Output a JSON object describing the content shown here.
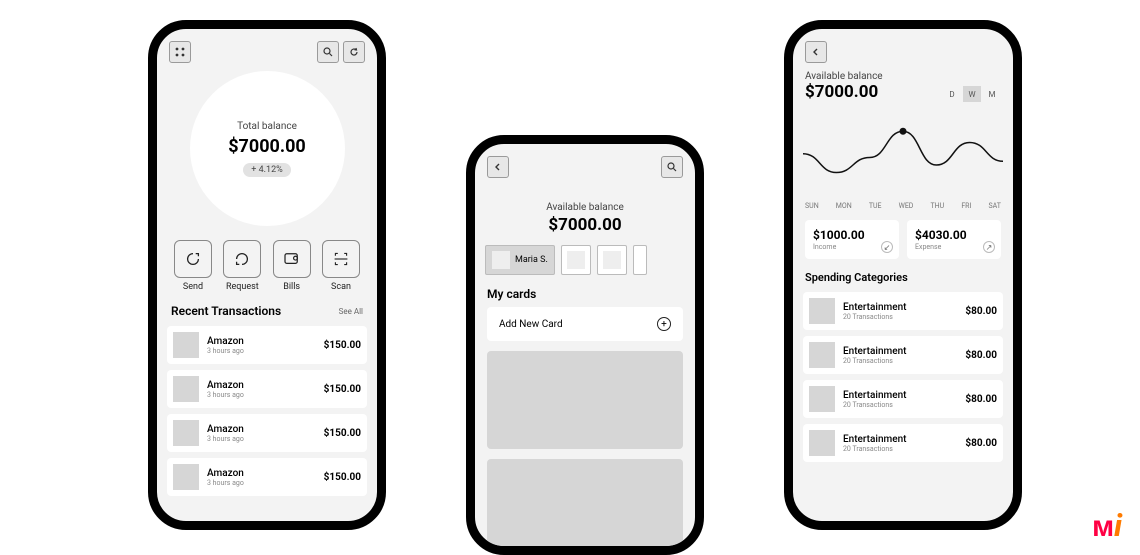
{
  "home": {
    "balance_label": "Total balance",
    "balance_amount": "$7000.00",
    "change": "+ 4.12%",
    "actions": [
      {
        "label": "Send"
      },
      {
        "label": "Request"
      },
      {
        "label": "Bills"
      },
      {
        "label": "Scan"
      }
    ],
    "recent_title": "Recent Transactions",
    "see_all": "See All",
    "transactions": [
      {
        "name": "Amazon",
        "time": "3 hours ago",
        "amount": "$150.00"
      },
      {
        "name": "Amazon",
        "time": "3 hours ago",
        "amount": "$150.00"
      },
      {
        "name": "Amazon",
        "time": "3 hours ago",
        "amount": "$150.00"
      },
      {
        "name": "Amazon",
        "time": "3 hours ago",
        "amount": "$150.00"
      }
    ]
  },
  "cards": {
    "balance_label": "Available balance",
    "balance_amount": "$7000.00",
    "selected_user": "Maria S.",
    "mycards_title": "My cards",
    "add_label": "Add New Card"
  },
  "analytics": {
    "balance_label": "Available balance",
    "balance_amount": "$7000.00",
    "tabs": [
      "D",
      "W",
      "M"
    ],
    "active_tab": "W",
    "days": [
      "SUN",
      "MON",
      "TUE",
      "WED",
      "THU",
      "FRI",
      "SAT"
    ],
    "income_amount": "$1000.00",
    "income_label": "Income",
    "expense_amount": "$4030.00",
    "expense_label": "Expense",
    "spending_title": "Spending Categories",
    "categories": [
      {
        "name": "Entertainment",
        "sub": "20 Transactions",
        "amount": "$80.00"
      },
      {
        "name": "Entertainment",
        "sub": "20 Transactions",
        "amount": "$80.00"
      },
      {
        "name": "Entertainment",
        "sub": "20 Transactions",
        "amount": "$80.00"
      },
      {
        "name": "Entertainment",
        "sub": "20 Transactions",
        "amount": "$80.00"
      }
    ]
  },
  "chart_data": {
    "type": "line",
    "categories": [
      "SUN",
      "MON",
      "TUE",
      "WED",
      "THU",
      "FRI",
      "SAT"
    ],
    "values": [
      55,
      30,
      50,
      85,
      40,
      70,
      45
    ],
    "title": "",
    "xlabel": "",
    "ylabel": "",
    "ylim": [
      0,
      100
    ],
    "marker_index": 3
  }
}
